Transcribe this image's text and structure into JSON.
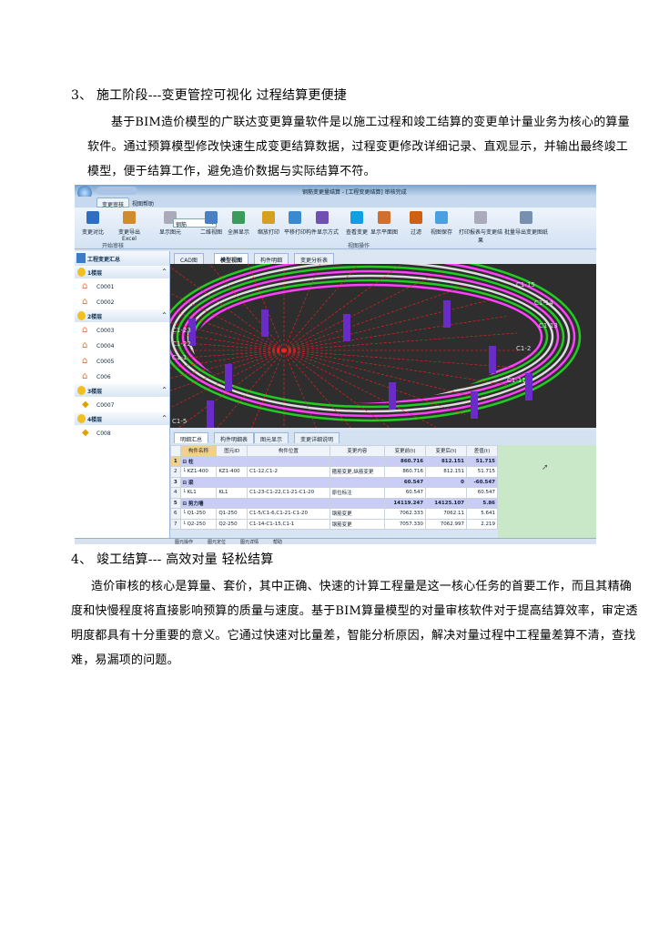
{
  "section3": {
    "heading": "3、   施工阶段---变更管控可视化 过程结算更便捷",
    "lines": [
      "基于BIM造价模型的广联达变更算量软件是以施工过程和竣工结算的变更单计量业务为核心的算量",
      "软件。通过预算模型修改快速生成变更结算数据，过程变更修改详细记录、直观显示，并输出最终竣工",
      "模型，便于结算工作，避免造价数据与实际结算不符。"
    ]
  },
  "app": {
    "title": "钢筋变更量结算 - [工程变更结算] 审核完成",
    "tabs": [
      "变更审核",
      "视图帮助"
    ],
    "ribbon": [
      "变更对比",
      "变更导出Excel",
      "显示图元",
      "钢筋",
      "楼层",
      "二维视图",
      "全屏显示",
      "缩放打印",
      "平移打印",
      "构件显示方式",
      "查看变更",
      "显示平面图",
      "过滤",
      "视图保存",
      "打印报表与变更结果",
      "批量导出变更图纸"
    ],
    "groups": [
      "开始审核",
      "视图操作"
    ],
    "left_header": "工程变更汇总",
    "left_groups": [
      {
        "label": "1楼层",
        "items": [
          "C0001",
          "C0002"
        ]
      },
      {
        "label": "2楼层",
        "items": [
          "C0003",
          "C0004",
          "C0005",
          "C006"
        ]
      },
      {
        "label": "3楼层",
        "items": [
          "C0007"
        ]
      },
      {
        "label": "4楼层",
        "items": [
          "C008"
        ]
      }
    ],
    "view_tabs": [
      "CAD图",
      "模型视图",
      "构件明细",
      "变更分析表"
    ],
    "axis_labels": [
      "C1-15",
      "C1-14",
      "C1-13",
      "C1-2",
      "C1-11",
      "C1-23",
      "C1-22",
      "C1-1",
      "C1-5"
    ],
    "bottom_tabs": [
      "明细汇总",
      "构件明细表",
      "图元显示",
      "变更详细说明"
    ],
    "table": {
      "headers": [
        "",
        "构件名称",
        "图元ID",
        "构件位置",
        "变更内容",
        "变更前(t)",
        "变更后(t)",
        "差值(t)"
      ],
      "rows": [
        [
          "1",
          "⊟ 柱",
          "",
          "",
          "",
          "860.716",
          "812.151",
          "51.715"
        ],
        [
          "2",
          "└ KZ1-400",
          "KZ1-400",
          "C1-12,C1-2",
          "箍筋变更,纵筋变更",
          "860.716",
          "812.151",
          "51.715"
        ],
        [
          "3",
          "⊟ 梁",
          "",
          "",
          "",
          "60.547",
          "0",
          "-60.547"
        ],
        [
          "4",
          "└ KL1",
          "KL1",
          "C1-23-C1-22,C1-21-C1-20",
          "原位标注",
          "60.547",
          "",
          "60.547"
        ],
        [
          "5",
          "⊟ 剪力墙",
          "",
          "",
          "",
          "14119.247",
          "14125.107",
          "5.86"
        ],
        [
          "6",
          "└ Q1-250",
          "Q1-250",
          "C1-5/C1-6,C1-21-C1-20",
          "钢筋变更",
          "7062.333",
          "7062.11",
          "5.641"
        ],
        [
          "7",
          "└ Q2-250",
          "Q2-250",
          "C1-14-C1-15,C1-1",
          "钢筋变更",
          "7057.330",
          "7062.997",
          "2.219"
        ]
      ]
    },
    "status": [
      "图元操作",
      "图元定位",
      "图元详情",
      "帮助"
    ],
    "colors": {
      "ribbon": "#d6e4f3",
      "view_bg": "#2e2e2e",
      "ring": "#22cc22",
      "grid": "#ff2020",
      "column": "#6a2cc8",
      "group_row": "#c9ccf5"
    }
  },
  "section4": {
    "heading": "4、    竣工结算--- 高效对量 轻松结算",
    "lines": [
      "造价审核的核心是算量、套价，其中正确、快速的计算工程量是这一核心任务的首要工作，而且其精确",
      "度和快慢程度将直接影响预算的质量与速度。基于BIM算量模型的对量审核软件对于提高结算效率，审定透",
      "明度都具有十分重要的意义。它通过快速对比量差，智能分析原因，解决对量过程中工程量差算不清，查找",
      "难，易漏项的问题。"
    ]
  }
}
